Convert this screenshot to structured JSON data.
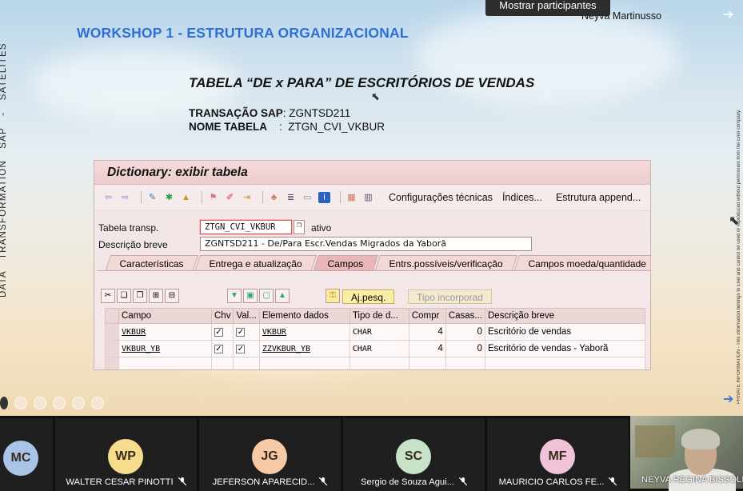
{
  "slide": {
    "workshop_title": "WORKSHOP 1  -  ESTRUTURA ORGANIZACIONAL",
    "side_text": [
      "DATA",
      "TRANSFORMATION",
      "SAP",
      "-",
      "SATÉLITES"
    ],
    "table_title": "TABELA “DE x PARA” DE  ESCRITÓRIOS DE VENDAS",
    "transacao_label": "TRANSAÇÃO SAP",
    "transacao_value": ":  ZGNTSD211",
    "nome_label": "NOME TABELA",
    "nome_value": "    :  ZTGN_CVI_VKBUR",
    "right_notice": "PRIVATE INFORMATION - This information belongs to Enel and cannot be used or reproduced without permission from the Enel company."
  },
  "meeting": {
    "mostrar_button": "Mostrar participantes",
    "presenter_name": "Neyva Martinusso"
  },
  "sap": {
    "window_title": "Dictionary: exibir tabela",
    "toolbar": {
      "config_tecnicas": "Configurações técnicas",
      "indices": "Índices...",
      "estrutura_append": "Estrutura append..."
    },
    "tabela_transp_label": "Tabela transp.",
    "tabela_transp_value": "ZTGN_CVI_VKBUR",
    "status": "ativo",
    "descricao_label": "Descrição breve",
    "descricao_value": "ZGNTSD211 - De/Para Escr.Vendas Migrados da Yaborã",
    "tabs": [
      "Características",
      "Entrega e atualização",
      "Campos",
      "Entrs.possíveis/verificação",
      "Campos moeda/quantidade"
    ],
    "active_tab": "Campos",
    "buttons": {
      "ajuda_pesquisa": "Aj.pesq.",
      "tipo_incorporado": "Tipo incorporad"
    },
    "grid": {
      "columns": [
        "Campo",
        "Chv",
        "Val...",
        "Elemento dados",
        "Tipo de d...",
        "Compr",
        "Casas...",
        "Descrição breve"
      ],
      "rows": [
        {
          "campo": "VKBUR",
          "chv": "✓",
          "val": "✓",
          "elemento": "VKBUR",
          "tipo": "CHAR",
          "compr": "4",
          "casas": "0",
          "descricao": "Escritório de vendas"
        },
        {
          "campo": "VKBUR_YB",
          "chv": "✓",
          "val": "✓",
          "elemento": "ZZVKBUR_YB",
          "tipo": "CHAR",
          "compr": "4",
          "casas": "0",
          "descricao": "Escritório de vendas - Yaborã"
        }
      ]
    }
  },
  "participants": [
    {
      "initials": "MC",
      "name": "",
      "color": "#a9c4e8"
    },
    {
      "initials": "WP",
      "name": "WALTER CESAR PINOTTI",
      "color": "#f6dc8c"
    },
    {
      "initials": "JG",
      "name": "JEFERSON APARECID...",
      "color": "#f7c9a5"
    },
    {
      "initials": "SC",
      "name": "Sergio de Souza Agui...",
      "color": "#c8e2c8"
    },
    {
      "initials": "MF",
      "name": "MAURICIO CARLOS FE...",
      "color": "#f1c3d9"
    },
    {
      "initials": "",
      "name": "NEYVA REGINA BISSOLI",
      "color": ""
    }
  ]
}
